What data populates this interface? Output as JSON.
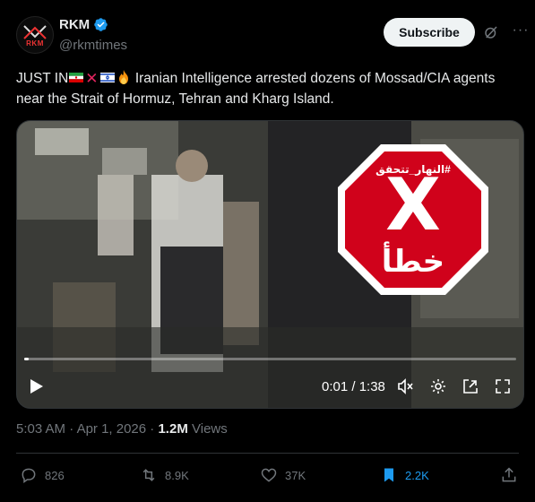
{
  "author": {
    "name": "RKM",
    "handle": "@rkmtimes",
    "avatar_text": "RKM",
    "verified": true
  },
  "header": {
    "subscribe_label": "Subscribe"
  },
  "tweet": {
    "text_prefix": "JUST IN",
    "text_body": " Iranian Intelligence arrested dozens of Mossad/CIA agents near the Strait of Hormuz, Tehran and Kharg Island."
  },
  "media": {
    "stamp_top": "#النهار_تتحقق",
    "stamp_mark": "X",
    "stamp_bottom": "خطأ",
    "current_time": "0:01",
    "duration": "1:38",
    "time_display": "0:01 / 1:38",
    "progress": 0.01
  },
  "meta": {
    "time": "5:03 AM",
    "date": "Apr 1, 2026",
    "views_count": "1.2M",
    "views_label": "Views"
  },
  "actions": {
    "replies": "826",
    "reposts": "8.9K",
    "likes": "37K",
    "bookmarks": "2.2K"
  },
  "colors": {
    "accent": "#1d9bf0",
    "stop_red": "#d0021b",
    "background": "#000000"
  }
}
